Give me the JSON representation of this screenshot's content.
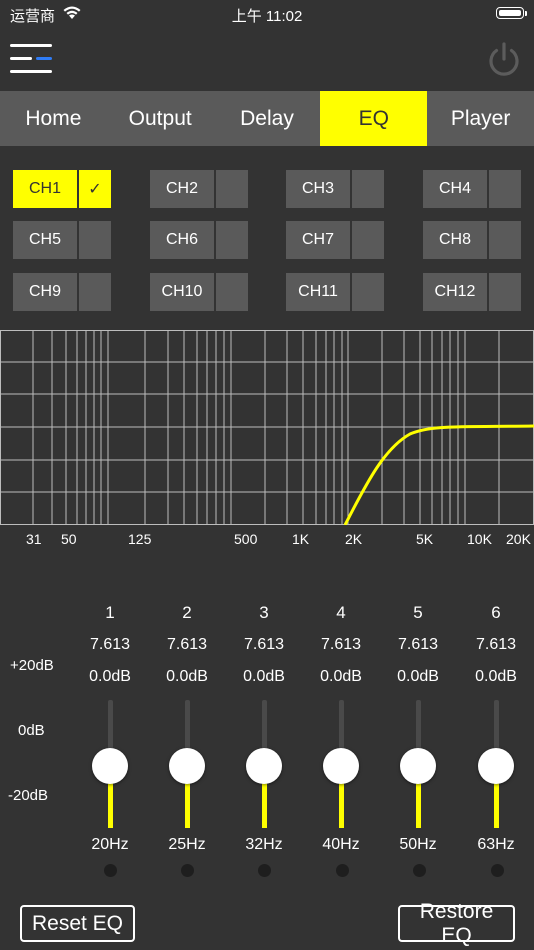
{
  "status": {
    "carrier": "运营商",
    "time": "上午 11:02"
  },
  "tabs": [
    {
      "label": "Home",
      "active": false
    },
    {
      "label": "Output",
      "active": false
    },
    {
      "label": "Delay",
      "active": false
    },
    {
      "label": "EQ",
      "active": true
    },
    {
      "label": "Player",
      "active": false
    }
  ],
  "channels": [
    {
      "label": "CH1",
      "checked": "✓"
    },
    {
      "label": "CH2",
      "checked": ""
    },
    {
      "label": "CH3",
      "checked": ""
    },
    {
      "label": "CH4",
      "checked": ""
    },
    {
      "label": "CH5",
      "checked": ""
    },
    {
      "label": "CH6",
      "checked": ""
    },
    {
      "label": "CH7",
      "checked": ""
    },
    {
      "label": "CH8",
      "checked": ""
    },
    {
      "label": "CH9",
      "checked": ""
    },
    {
      "label": "CH10",
      "checked": ""
    },
    {
      "label": "CH11",
      "checked": ""
    },
    {
      "label": "CH12",
      "checked": ""
    }
  ],
  "graph": {
    "freq_labels": [
      "31",
      "50",
      "125",
      "500",
      "1K",
      "2K",
      "5K",
      "10K",
      "20K"
    ],
    "curve_color": "#ffff00"
  },
  "db_axis": {
    "top": "+20dB",
    "mid": "0dB",
    "bottom": "-20dB"
  },
  "bands": [
    {
      "num": "1",
      "q": "7.613",
      "gain": "0.0dB",
      "freq": "20Hz",
      "level": 0.5
    },
    {
      "num": "2",
      "q": "7.613",
      "gain": "0.0dB",
      "freq": "25Hz",
      "level": 0.5
    },
    {
      "num": "3",
      "q": "7.613",
      "gain": "0.0dB",
      "freq": "32Hz",
      "level": 0.5
    },
    {
      "num": "4",
      "q": "7.613",
      "gain": "0.0dB",
      "freq": "40Hz",
      "level": 0.5
    },
    {
      "num": "5",
      "q": "7.613",
      "gain": "0.0dB",
      "freq": "50Hz",
      "level": 0.5
    },
    {
      "num": "6",
      "q": "7.613",
      "gain": "0.0dB",
      "freq": "63Hz",
      "level": 0.5
    }
  ],
  "buttons": {
    "reset": "Reset EQ",
    "restore": "Restore EQ"
  },
  "colors": {
    "accent": "#ffff00",
    "background": "#333333",
    "panel": "#5a5a5a",
    "menu_accent": "#2f7cf6"
  }
}
